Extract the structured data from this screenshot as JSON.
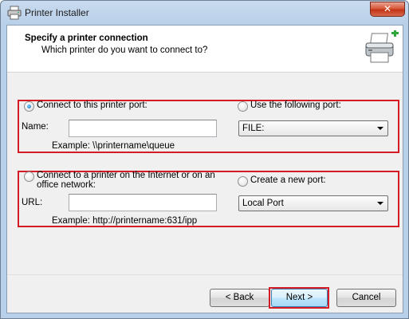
{
  "window": {
    "title": "Printer Installer",
    "close_label": "✕"
  },
  "header": {
    "title": "Specify a printer connection",
    "subtitle": "Which printer do you want to connect to?"
  },
  "group_local": {
    "radio_label": "Connect to this printer port:",
    "name_label": "Name:",
    "name_value": "",
    "example": "Example: \\\\printername\\queue",
    "port_radio_label": "Use the following port:",
    "port_selected": "FILE:"
  },
  "group_internet": {
    "radio_label": "Connect to a printer on the Internet or on an office network:",
    "url_label": "URL:",
    "url_value": "",
    "example": "Example: http://printername:631/ipp",
    "port_radio_label": "Create a new port:",
    "port_selected": "Local Port"
  },
  "buttons": {
    "back": "< Back",
    "next": "Next >",
    "cancel": "Cancel"
  },
  "colors": {
    "highlight": "#d41b26",
    "accent": "#3c7fb1"
  }
}
